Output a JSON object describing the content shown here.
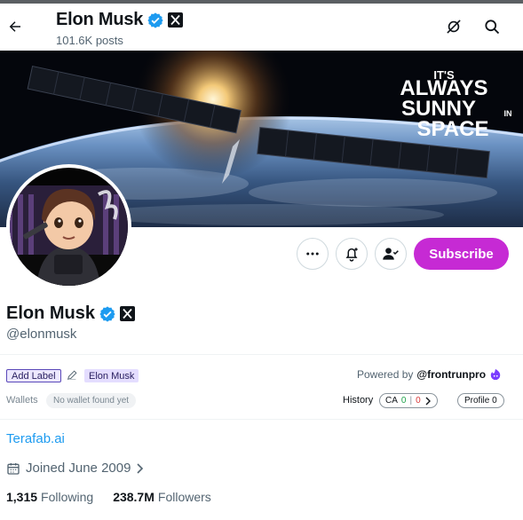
{
  "header": {
    "back_icon": "arrow-left-icon",
    "name": "Elon Musk",
    "posts": "101.6K posts",
    "icons": [
      "no-signal-icon",
      "search-icon"
    ]
  },
  "banner": {
    "line1": "IT'S",
    "line2": "ALWAYS",
    "line3": "SUNNY",
    "line3_small": "IN",
    "line4": "SPACE"
  },
  "profile": {
    "name": "Elon Musk",
    "handle": "@elonmusk",
    "verified_color": "#1d9bf0",
    "actions": {
      "more_icon": "more-dots-icon",
      "notify_icon": "bell-plus-icon",
      "follow_icon": "person-check-icon",
      "subscribe_label": "Subscribe",
      "subscribe_color": "#c62ad4"
    }
  },
  "extension": {
    "add_label": "Add Label",
    "label_name": "Elon Musk",
    "powered_prefix": "Powered by",
    "powered_brand": "@frontrunpro",
    "wallets_label": "Wallets",
    "wallet_status": "No wallet found yet",
    "history_label": "History",
    "ca_label": "CA",
    "ca_green": "0",
    "ca_red": "0",
    "profile_label": "Profile",
    "profile_count": "0"
  },
  "details": {
    "website": "Terafab.ai",
    "joined": "Joined June 2009",
    "following_count": "1,315",
    "following_label": "Following",
    "followers_count": "238.7M",
    "followers_label": "Followers"
  }
}
